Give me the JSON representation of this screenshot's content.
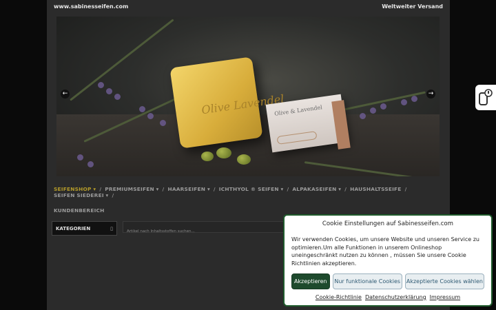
{
  "topbar": {
    "site": "www.sabinesseifen.com",
    "shipping": "Weltweiter Versand"
  },
  "hero": {
    "soap_label": "Olive Lavendel",
    "box_label": "Olive & Lavendel",
    "prev_icon": "arrow-left-icon",
    "next_icon": "arrow-right-icon"
  },
  "nav": {
    "items": [
      {
        "label": "SEIFENSHOP",
        "dropdown": true,
        "active": true
      },
      {
        "label": "PREMIUMSEIFEN",
        "dropdown": true
      },
      {
        "label": "HAARSEIFEN",
        "dropdown": true
      },
      {
        "label": "ICHTHYOL ® SEIFEN",
        "dropdown": true
      },
      {
        "label": "ALPAKASEIFEN",
        "dropdown": true
      },
      {
        "label": "HAUSHALTSSEIFE",
        "dropdown": false
      },
      {
        "label": "SEIFEN SIEDEREI",
        "dropdown": true
      }
    ],
    "row2": "KUNDENBEREICH",
    "active_color": "#b39a2a"
  },
  "categories": {
    "label": "KATEGORIEN",
    "icon": "list-icon"
  },
  "search": {
    "placeholder": "Artikel nach Inhaltsstoffen suchen..."
  },
  "cookie": {
    "title": "Cookie Einstellungen auf Sabinesseifen.com",
    "body": "Wir verwenden Cookies, um unsere Website und unseren Service zu optimieren.Um alle Funktionen in unserem Onlineshop uneingeschränkt nutzen zu können , müssen Sie unsere Cookie Richtlinien akzeptieren.",
    "accept_label": "Akzeptieren",
    "functional_label": "Nur funktionale Cookies",
    "choose_label": "Akzeptierte Cookies wählen",
    "links": [
      "Cookie-Richtlinie",
      "Datenschutzerklärung",
      "Impressum"
    ],
    "accent": "#1e4a2d"
  },
  "side_widget": {
    "icon": "phone-badge-icon"
  }
}
